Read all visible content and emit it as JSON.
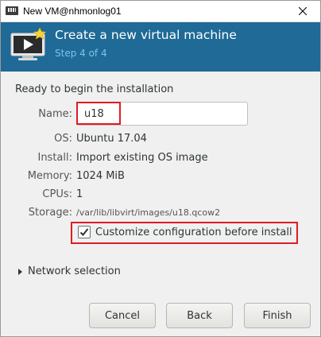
{
  "window": {
    "title": "New VM@nhmonlog01"
  },
  "banner": {
    "title": "Create a new virtual machine",
    "step": "Step 4 of 4"
  },
  "intro": "Ready to begin the installation",
  "fields": {
    "name_label": "Name:",
    "name_value": "u18",
    "os_label": "OS:",
    "os_value": "Ubuntu 17.04",
    "install_label": "Install:",
    "install_value": "Import existing OS image",
    "memory_label": "Memory:",
    "memory_value": "1024 MiB",
    "cpus_label": "CPUs:",
    "cpus_value": "1",
    "storage_label": "Storage:",
    "storage_value": "/var/lib/libvirt/images/u18.qcow2"
  },
  "customize": {
    "label": "Customize configuration before install",
    "checked": true
  },
  "network": {
    "label": "Network selection"
  },
  "buttons": {
    "cancel": "Cancel",
    "back": "Back",
    "finish": "Finish"
  },
  "colors": {
    "banner": "#1f6a96",
    "highlight": "#e01b24",
    "step_text": "#7fc3ea"
  },
  "icons": [
    "vm-manager-icon",
    "close-icon",
    "virtual-machine-monitor-icon",
    "star-icon",
    "checkmark-icon",
    "expander-arrow-icon"
  ]
}
